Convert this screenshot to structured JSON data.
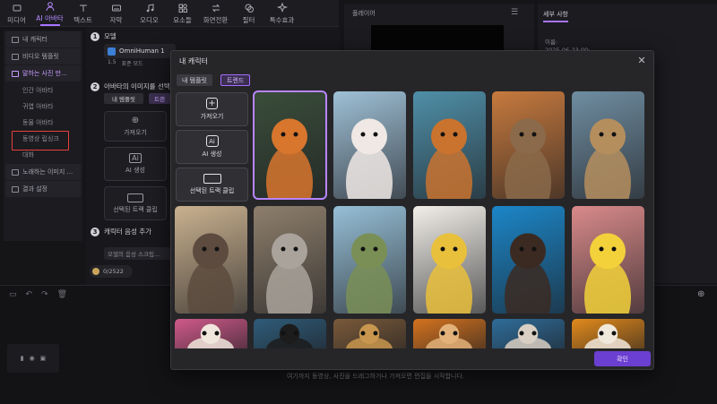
{
  "toolbar": {
    "items": [
      {
        "label": "미디어",
        "icon": "media-icon"
      },
      {
        "label": "AI 아바타",
        "icon": "ai-avatar-icon",
        "active": true
      },
      {
        "label": "텍스트",
        "icon": "text-icon"
      },
      {
        "label": "자막",
        "icon": "subtitle-icon"
      },
      {
        "label": "오디오",
        "icon": "audio-icon"
      },
      {
        "label": "요소들",
        "icon": "elements-icon"
      },
      {
        "label": "화면전환",
        "icon": "transition-icon"
      },
      {
        "label": "필터",
        "icon": "filter-icon"
      },
      {
        "label": "특수효과",
        "icon": "effects-icon"
      }
    ]
  },
  "sidebar": {
    "my_character": "내 캐릭터",
    "video_template": "비디오 템플릿",
    "talking_photo": "말하는 사진 만...",
    "human_avatar": "인간 아바타",
    "cute_avatar": "귀엽 아바타",
    "animal_avatar": "동물 아바타",
    "video_lipsync": "동영상 립싱크",
    "chat": "대화",
    "singing_image": "노래하는 이미지 ...",
    "result": "결과 설정"
  },
  "steps": {
    "step1": {
      "num": "1",
      "title": "모델",
      "model_name": "OmniHuman 1",
      "chips": [
        "1.5",
        "표준 모드"
      ]
    },
    "step2": {
      "num": "2",
      "title": "아바타의 이미지를 선택...",
      "tabs": [
        "내 템플릿",
        "트렌"
      ],
      "import_label": "가져오기",
      "ai_gen_label": "AI 생성",
      "track_clip_label": "선택된 트랙 클립"
    },
    "step3": {
      "num": "3",
      "title": "캐릭터 음성 추가",
      "input_placeholder": "모델의 음성 스크립..."
    },
    "credits": "0/2522"
  },
  "player": {
    "title": "플레이어"
  },
  "right_panel": {
    "tab": "세부 사항",
    "label1": "이름:",
    "value1": "2025-06-23 00:..."
  },
  "timeline": {
    "hint": "여기까지 동영상, 사진을 드래그하거나 가져오면 편집을 시작합니다."
  },
  "modal": {
    "title": "내 캐릭터",
    "tabs": {
      "template": "내 템플릿",
      "trend": "트렌드"
    },
    "buttons": {
      "import": "가져오기",
      "ai_generate": "AI 생성",
      "track_clip": "선택된 트랙 클립"
    },
    "confirm": "확인",
    "images": [
      {
        "name": "fox-character-image",
        "bg": "#3a4d3a",
        "animal": "#d8762e",
        "row": 0,
        "col": 0,
        "selected": true
      },
      {
        "name": "white-cat-image",
        "bg": "#9fc0d6",
        "animal": "#efe8e4",
        "row": 0,
        "col": 1
      },
      {
        "name": "owl-in-hat-image",
        "bg": "#4f8fa8",
        "animal": "#c9732f",
        "row": 0,
        "col": 2
      },
      {
        "name": "sloth-image",
        "bg": "#c77a3e",
        "animal": "#8a6a4a",
        "row": 0,
        "col": 3
      },
      {
        "name": "meerkat-image",
        "bg": "#6f8da1",
        "animal": "#b58e5e",
        "row": 0,
        "col": 4
      },
      {
        "name": "otter-image",
        "bg": "#c9b18f",
        "animal": "#5c4b3e",
        "row": 1,
        "col": 0
      },
      {
        "name": "koala-image",
        "bg": "#8e7f6c",
        "animal": "#a9a39b",
        "row": 1,
        "col": 1
      },
      {
        "name": "turtle-image",
        "bg": "#96bfd6",
        "animal": "#7a8f56",
        "row": 1,
        "col": 2
      },
      {
        "name": "hamster-in-hoodie-image",
        "bg": "#f2efe9",
        "animal": "#e9c03b",
        "row": 1,
        "col": 3
      },
      {
        "name": "dog-image",
        "bg": "#1c86c8",
        "animal": "#3b2a22",
        "row": 1,
        "col": 4
      },
      {
        "name": "duckling-image",
        "bg": "#d98a8a",
        "animal": "#f2d13a",
        "row": 1,
        "col": 5
      },
      {
        "name": "llama-image",
        "bg": "#d05a8a",
        "animal": "#f0e6dc",
        "row": 2,
        "col": 0
      },
      {
        "name": "bee-image",
        "bg": "#2f5c7a",
        "animal": "#1c1c1c",
        "row": 2,
        "col": 1
      },
      {
        "name": "cheetah-image",
        "bg": "#7a5a3a",
        "animal": "#c8964e",
        "row": 2,
        "col": 2
      },
      {
        "name": "cat-sunglasses-image",
        "bg": "#d4731f",
        "animal": "#e2b27a",
        "row": 2,
        "col": 3
      },
      {
        "name": "goat-image",
        "bg": "#2f6d9a",
        "animal": "#d9cfc2",
        "row": 2,
        "col": 4
      },
      {
        "name": "sheep-image",
        "bg": "#e28a1c",
        "animal": "#f0e8da",
        "row": 2,
        "col": 5
      }
    ]
  }
}
